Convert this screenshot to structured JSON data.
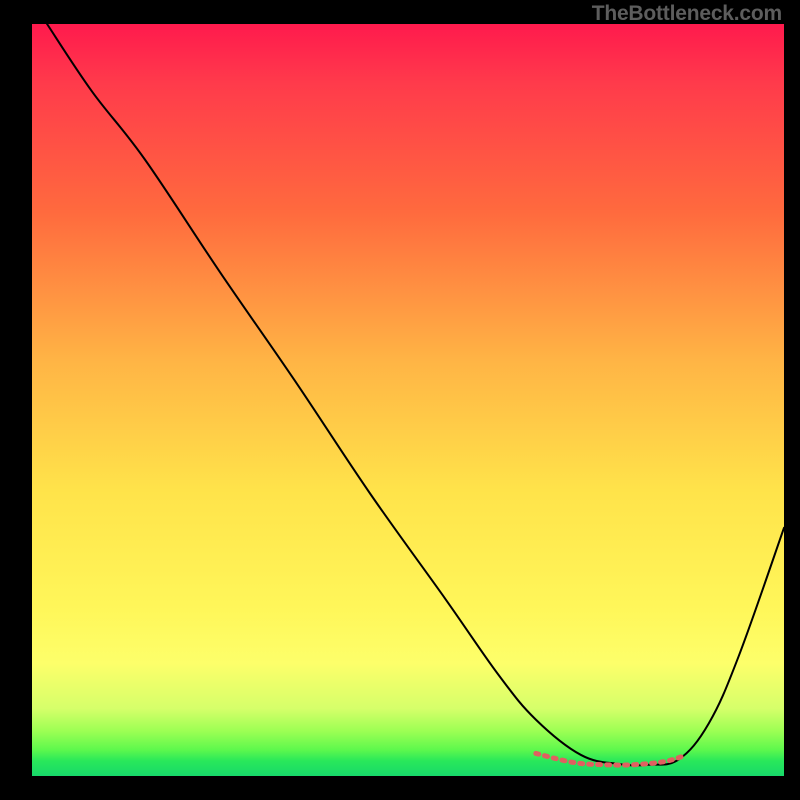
{
  "watermark": {
    "text": "TheBottleneck.com"
  },
  "chart_data": {
    "type": "line",
    "title": "",
    "xlabel": "",
    "ylabel": "",
    "xlim": [
      0,
      100
    ],
    "ylim": [
      0,
      100
    ],
    "grid": false,
    "legend": false,
    "gradient_axis": "y",
    "gradient_stops": [
      {
        "pos": 0.0,
        "color": "#ff1a4d"
      },
      {
        "pos": 0.08,
        "color": "#ff3b4b"
      },
      {
        "pos": 0.25,
        "color": "#ff6a3e"
      },
      {
        "pos": 0.45,
        "color": "#ffb545"
      },
      {
        "pos": 0.62,
        "color": "#ffe34a"
      },
      {
        "pos": 0.78,
        "color": "#fff75a"
      },
      {
        "pos": 0.85,
        "color": "#fdff6a"
      },
      {
        "pos": 0.91,
        "color": "#d6ff6a"
      },
      {
        "pos": 0.94,
        "color": "#9dff54"
      },
      {
        "pos": 0.965,
        "color": "#5ef84d"
      },
      {
        "pos": 0.98,
        "color": "#29e85a"
      },
      {
        "pos": 1.0,
        "color": "#17d86a"
      }
    ],
    "series": [
      {
        "name": "main-curve",
        "color": "#000000",
        "stroke_width": 2,
        "x": [
          2.0,
          8.0,
          15.0,
          25.0,
          35.0,
          45.0,
          55.0,
          62.0,
          67.0,
          73.0,
          78.0,
          82.0,
          86.0,
          90.0,
          94.0,
          100.0
        ],
        "values": [
          100.0,
          91.0,
          82.0,
          67.0,
          52.5,
          37.5,
          23.5,
          13.5,
          7.5,
          2.8,
          1.6,
          1.5,
          2.2,
          7.0,
          16.0,
          33.0
        ]
      },
      {
        "name": "bottom-highlight",
        "color": "#e06060",
        "stroke_width": 5,
        "dash": "3,6",
        "x": [
          67.0,
          72.0,
          76.0,
          80.0,
          84.0,
          86.5
        ],
        "values": [
          3.0,
          1.8,
          1.5,
          1.5,
          1.9,
          2.6
        ]
      }
    ]
  }
}
